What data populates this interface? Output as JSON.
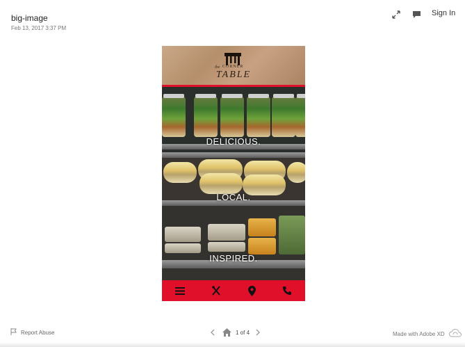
{
  "header": {
    "title": "big-image",
    "date": "Feb 13, 2017 3:37 PM",
    "sign_in": "Sign In",
    "icons": [
      "expand-icon",
      "comment-icon"
    ]
  },
  "artboard": {
    "brand": {
      "the": "the",
      "corner": "CORNER",
      "name": "TABLE"
    },
    "taglines": [
      "DELICIOUS.",
      "LOCAL.",
      "INSPIRED."
    ],
    "nav_icons": [
      "menu-icon",
      "utensils-icon",
      "location-pin-icon",
      "phone-icon"
    ],
    "colors": {
      "accent_red": "#e0102a",
      "brand_brown": "#b58f6b"
    }
  },
  "footer": {
    "report_abuse": "Report Abuse",
    "page_indicator": "1 of 4",
    "made_with": "Made with Adobe XD"
  }
}
